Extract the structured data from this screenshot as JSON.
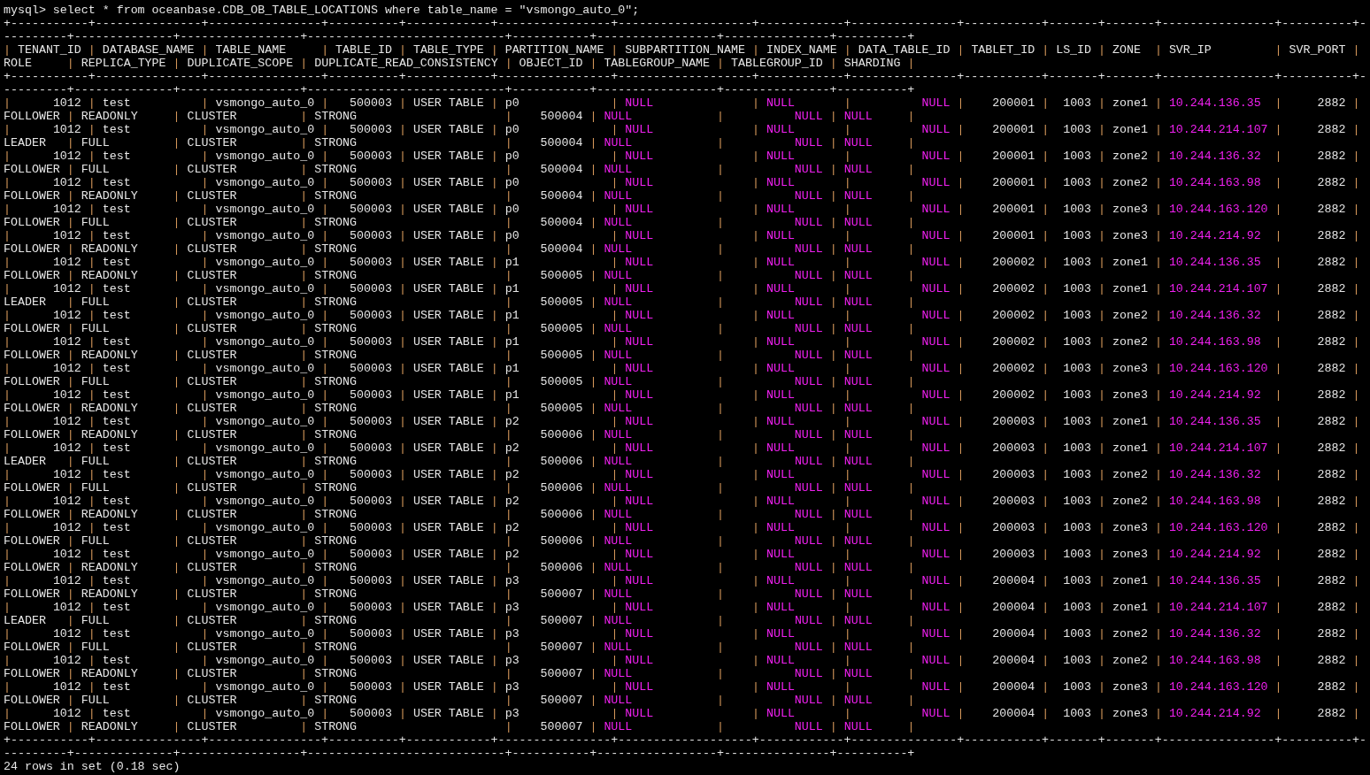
{
  "command_line": "mysql> select * from oceanbase.CDB_OB_TABLE_LOCATIONS where table_name = \"vsmongo_auto_0\";",
  "frame": {
    "bar": "|"
  },
  "border_top": [
    "+-----------+---------------+----------------+----------+------------+----------------+-------------------+------------+---------------+-----------+-------+-------+----------------+----------+-",
    "---------+--------------+-----------------+----------------------------+-----------+-----------------+---------------+----------+"
  ],
  "border_header": [
    "+-----------+---------------+----------------+----------+------------+----------------+-------------------+------------+---------------+-----------+-------+-------+----------------+----------+-",
    "---------+--------------+-----------------+----------------------------+-----------+-----------------+---------------+----------+"
  ],
  "border_bottom": [
    "+-----------+---------------+----------------+----------+------------+----------------+-------------------+------------+---------------+-----------+-------+-------+----------------+----------+-",
    "---------+--------------+-----------------+----------------------------+-----------+-----------------+---------------+----------+"
  ],
  "columns": [
    {
      "name": "TENANT_ID",
      "kind": "number"
    },
    {
      "name": "DATABASE_NAME",
      "kind": "text"
    },
    {
      "name": "TABLE_NAME",
      "kind": "text"
    },
    {
      "name": "TABLE_ID",
      "kind": "number"
    },
    {
      "name": "TABLE_TYPE",
      "kind": "text"
    },
    {
      "name": "PARTITION_NAME",
      "kind": "text"
    },
    {
      "name": "SUBPARTITION_NAME",
      "kind": "text"
    },
    {
      "name": "INDEX_NAME",
      "kind": "text"
    },
    {
      "name": "DATA_TABLE_ID",
      "kind": "number"
    },
    {
      "name": "TABLET_ID",
      "kind": "number"
    },
    {
      "name": "LS_ID",
      "kind": "number"
    },
    {
      "name": "ZONE",
      "kind": "text"
    },
    {
      "name": "SVR_IP",
      "kind": "address"
    },
    {
      "name": "SVR_PORT",
      "kind": "number"
    },
    {
      "name": "ROLE",
      "kind": "text"
    },
    {
      "name": "REPLICA_TYPE",
      "kind": "text"
    },
    {
      "name": "DUPLICATE_SCOPE",
      "kind": "text"
    },
    {
      "name": "DUPLICATE_READ_CONSISTENCY",
      "kind": "text"
    },
    {
      "name": "OBJECT_ID",
      "kind": "number"
    },
    {
      "name": "TABLEGROUP_NAME",
      "kind": "text"
    },
    {
      "name": "TABLEGROUP_ID",
      "kind": "number"
    },
    {
      "name": "SHARDING",
      "kind": "text"
    }
  ],
  "rows": [
    [
      "1012",
      "test",
      "vsmongo_auto_0",
      "500003",
      "USER TABLE",
      "p0",
      {
        "text": "NULL",
        "kind": "null"
      },
      {
        "text": "NULL",
        "kind": "null"
      },
      {
        "text": "NULL",
        "kind": "null"
      },
      "200001",
      "1003",
      "zone1",
      "10.244.136.35",
      "2882",
      "FOLLOWER",
      "READONLY",
      "CLUSTER",
      "STRONG",
      "500004",
      {
        "text": "NULL",
        "kind": "null"
      },
      {
        "text": "NULL",
        "kind": "null"
      },
      {
        "text": "NULL",
        "kind": "null"
      }
    ],
    [
      "1012",
      "test",
      "vsmongo_auto_0",
      "500003",
      "USER TABLE",
      "p0",
      {
        "text": "NULL",
        "kind": "null"
      },
      {
        "text": "NULL",
        "kind": "null"
      },
      {
        "text": "NULL",
        "kind": "null"
      },
      "200001",
      "1003",
      "zone1",
      "10.244.214.107",
      "2882",
      "LEADER",
      "FULL",
      "CLUSTER",
      "STRONG",
      "500004",
      {
        "text": "NULL",
        "kind": "null"
      },
      {
        "text": "NULL",
        "kind": "null"
      },
      {
        "text": "NULL",
        "kind": "null"
      }
    ],
    [
      "1012",
      "test",
      "vsmongo_auto_0",
      "500003",
      "USER TABLE",
      "p0",
      {
        "text": "NULL",
        "kind": "null"
      },
      {
        "text": "NULL",
        "kind": "null"
      },
      {
        "text": "NULL",
        "kind": "null"
      },
      "200001",
      "1003",
      "zone2",
      "10.244.136.32",
      "2882",
      "FOLLOWER",
      "FULL",
      "CLUSTER",
      "STRONG",
      "500004",
      {
        "text": "NULL",
        "kind": "null"
      },
      {
        "text": "NULL",
        "kind": "null"
      },
      {
        "text": "NULL",
        "kind": "null"
      }
    ],
    [
      "1012",
      "test",
      "vsmongo_auto_0",
      "500003",
      "USER TABLE",
      "p0",
      {
        "text": "NULL",
        "kind": "null"
      },
      {
        "text": "NULL",
        "kind": "null"
      },
      {
        "text": "NULL",
        "kind": "null"
      },
      "200001",
      "1003",
      "zone2",
      "10.244.163.98",
      "2882",
      "FOLLOWER",
      "READONLY",
      "CLUSTER",
      "STRONG",
      "500004",
      {
        "text": "NULL",
        "kind": "null"
      },
      {
        "text": "NULL",
        "kind": "null"
      },
      {
        "text": "NULL",
        "kind": "null"
      }
    ],
    [
      "1012",
      "test",
      "vsmongo_auto_0",
      "500003",
      "USER TABLE",
      "p0",
      {
        "text": "NULL",
        "kind": "null"
      },
      {
        "text": "NULL",
        "kind": "null"
      },
      {
        "text": "NULL",
        "kind": "null"
      },
      "200001",
      "1003",
      "zone3",
      "10.244.163.120",
      "2882",
      "FOLLOWER",
      "FULL",
      "CLUSTER",
      "STRONG",
      "500004",
      {
        "text": "NULL",
        "kind": "null"
      },
      {
        "text": "NULL",
        "kind": "null"
      },
      {
        "text": "NULL",
        "kind": "null"
      }
    ],
    [
      "1012",
      "test",
      "vsmongo_auto_0",
      "500003",
      "USER TABLE",
      "p0",
      {
        "text": "NULL",
        "kind": "null"
      },
      {
        "text": "NULL",
        "kind": "null"
      },
      {
        "text": "NULL",
        "kind": "null"
      },
      "200001",
      "1003",
      "zone3",
      "10.244.214.92",
      "2882",
      "FOLLOWER",
      "READONLY",
      "CLUSTER",
      "STRONG",
      "500004",
      {
        "text": "NULL",
        "kind": "null"
      },
      {
        "text": "NULL",
        "kind": "null"
      },
      {
        "text": "NULL",
        "kind": "null"
      }
    ],
    [
      "1012",
      "test",
      "vsmongo_auto_0",
      "500003",
      "USER TABLE",
      "p1",
      {
        "text": "NULL",
        "kind": "null"
      },
      {
        "text": "NULL",
        "kind": "null"
      },
      {
        "text": "NULL",
        "kind": "null"
      },
      "200002",
      "1003",
      "zone1",
      "10.244.136.35",
      "2882",
      "FOLLOWER",
      "READONLY",
      "CLUSTER",
      "STRONG",
      "500005",
      {
        "text": "NULL",
        "kind": "null"
      },
      {
        "text": "NULL",
        "kind": "null"
      },
      {
        "text": "NULL",
        "kind": "null"
      }
    ],
    [
      "1012",
      "test",
      "vsmongo_auto_0",
      "500003",
      "USER TABLE",
      "p1",
      {
        "text": "NULL",
        "kind": "null"
      },
      {
        "text": "NULL",
        "kind": "null"
      },
      {
        "text": "NULL",
        "kind": "null"
      },
      "200002",
      "1003",
      "zone1",
      "10.244.214.107",
      "2882",
      "LEADER",
      "FULL",
      "CLUSTER",
      "STRONG",
      "500005",
      {
        "text": "NULL",
        "kind": "null"
      },
      {
        "text": "NULL",
        "kind": "null"
      },
      {
        "text": "NULL",
        "kind": "null"
      }
    ],
    [
      "1012",
      "test",
      "vsmongo_auto_0",
      "500003",
      "USER TABLE",
      "p1",
      {
        "text": "NULL",
        "kind": "null"
      },
      {
        "text": "NULL",
        "kind": "null"
      },
      {
        "text": "NULL",
        "kind": "null"
      },
      "200002",
      "1003",
      "zone2",
      "10.244.136.32",
      "2882",
      "FOLLOWER",
      "FULL",
      "CLUSTER",
      "STRONG",
      "500005",
      {
        "text": "NULL",
        "kind": "null"
      },
      {
        "text": "NULL",
        "kind": "null"
      },
      {
        "text": "NULL",
        "kind": "null"
      }
    ],
    [
      "1012",
      "test",
      "vsmongo_auto_0",
      "500003",
      "USER TABLE",
      "p1",
      {
        "text": "NULL",
        "kind": "null"
      },
      {
        "text": "NULL",
        "kind": "null"
      },
      {
        "text": "NULL",
        "kind": "null"
      },
      "200002",
      "1003",
      "zone2",
      "10.244.163.98",
      "2882",
      "FOLLOWER",
      "READONLY",
      "CLUSTER",
      "STRONG",
      "500005",
      {
        "text": "NULL",
        "kind": "null"
      },
      {
        "text": "NULL",
        "kind": "null"
      },
      {
        "text": "NULL",
        "kind": "null"
      }
    ],
    [
      "1012",
      "test",
      "vsmongo_auto_0",
      "500003",
      "USER TABLE",
      "p1",
      {
        "text": "NULL",
        "kind": "null"
      },
      {
        "text": "NULL",
        "kind": "null"
      },
      {
        "text": "NULL",
        "kind": "null"
      },
      "200002",
      "1003",
      "zone3",
      "10.244.163.120",
      "2882",
      "FOLLOWER",
      "FULL",
      "CLUSTER",
      "STRONG",
      "500005",
      {
        "text": "NULL",
        "kind": "null"
      },
      {
        "text": "NULL",
        "kind": "null"
      },
      {
        "text": "NULL",
        "kind": "null"
      }
    ],
    [
      "1012",
      "test",
      "vsmongo_auto_0",
      "500003",
      "USER TABLE",
      "p1",
      {
        "text": "NULL",
        "kind": "null"
      },
      {
        "text": "NULL",
        "kind": "null"
      },
      {
        "text": "NULL",
        "kind": "null"
      },
      "200002",
      "1003",
      "zone3",
      "10.244.214.92",
      "2882",
      "FOLLOWER",
      "READONLY",
      "CLUSTER",
      "STRONG",
      "500005",
      {
        "text": "NULL",
        "kind": "null"
      },
      {
        "text": "NULL",
        "kind": "null"
      },
      {
        "text": "NULL",
        "kind": "null"
      }
    ],
    [
      "1012",
      "test",
      "vsmongo_auto_0",
      "500003",
      "USER TABLE",
      "p2",
      {
        "text": "NULL",
        "kind": "null"
      },
      {
        "text": "NULL",
        "kind": "null"
      },
      {
        "text": "NULL",
        "kind": "null"
      },
      "200003",
      "1003",
      "zone1",
      "10.244.136.35",
      "2882",
      "FOLLOWER",
      "READONLY",
      "CLUSTER",
      "STRONG",
      "500006",
      {
        "text": "NULL",
        "kind": "null"
      },
      {
        "text": "NULL",
        "kind": "null"
      },
      {
        "text": "NULL",
        "kind": "null"
      }
    ],
    [
      "1012",
      "test",
      "vsmongo_auto_0",
      "500003",
      "USER TABLE",
      "p2",
      {
        "text": "NULL",
        "kind": "null"
      },
      {
        "text": "NULL",
        "kind": "null"
      },
      {
        "text": "NULL",
        "kind": "null"
      },
      "200003",
      "1003",
      "zone1",
      "10.244.214.107",
      "2882",
      "LEADER",
      "FULL",
      "CLUSTER",
      "STRONG",
      "500006",
      {
        "text": "NULL",
        "kind": "null"
      },
      {
        "text": "NULL",
        "kind": "null"
      },
      {
        "text": "NULL",
        "kind": "null"
      }
    ],
    [
      "1012",
      "test",
      "vsmongo_auto_0",
      "500003",
      "USER TABLE",
      "p2",
      {
        "text": "NULL",
        "kind": "null"
      },
      {
        "text": "NULL",
        "kind": "null"
      },
      {
        "text": "NULL",
        "kind": "null"
      },
      "200003",
      "1003",
      "zone2",
      "10.244.136.32",
      "2882",
      "FOLLOWER",
      "FULL",
      "CLUSTER",
      "STRONG",
      "500006",
      {
        "text": "NULL",
        "kind": "null"
      },
      {
        "text": "NULL",
        "kind": "null"
      },
      {
        "text": "NULL",
        "kind": "null"
      }
    ],
    [
      "1012",
      "test",
      "vsmongo_auto_0",
      "500003",
      "USER TABLE",
      "p2",
      {
        "text": "NULL",
        "kind": "null"
      },
      {
        "text": "NULL",
        "kind": "null"
      },
      {
        "text": "NULL",
        "kind": "null"
      },
      "200003",
      "1003",
      "zone2",
      "10.244.163.98",
      "2882",
      "FOLLOWER",
      "READONLY",
      "CLUSTER",
      "STRONG",
      "500006",
      {
        "text": "NULL",
        "kind": "null"
      },
      {
        "text": "NULL",
        "kind": "null"
      },
      {
        "text": "NULL",
        "kind": "null"
      }
    ],
    [
      "1012",
      "test",
      "vsmongo_auto_0",
      "500003",
      "USER TABLE",
      "p2",
      {
        "text": "NULL",
        "kind": "null"
      },
      {
        "text": "NULL",
        "kind": "null"
      },
      {
        "text": "NULL",
        "kind": "null"
      },
      "200003",
      "1003",
      "zone3",
      "10.244.163.120",
      "2882",
      "FOLLOWER",
      "FULL",
      "CLUSTER",
      "STRONG",
      "500006",
      {
        "text": "NULL",
        "kind": "null"
      },
      {
        "text": "NULL",
        "kind": "null"
      },
      {
        "text": "NULL",
        "kind": "null"
      }
    ],
    [
      "1012",
      "test",
      "vsmongo_auto_0",
      "500003",
      "USER TABLE",
      "p2",
      {
        "text": "NULL",
        "kind": "null"
      },
      {
        "text": "NULL",
        "kind": "null"
      },
      {
        "text": "NULL",
        "kind": "null"
      },
      "200003",
      "1003",
      "zone3",
      "10.244.214.92",
      "2882",
      "FOLLOWER",
      "READONLY",
      "CLUSTER",
      "STRONG",
      "500006",
      {
        "text": "NULL",
        "kind": "null"
      },
      {
        "text": "NULL",
        "kind": "null"
      },
      {
        "text": "NULL",
        "kind": "null"
      }
    ],
    [
      "1012",
      "test",
      "vsmongo_auto_0",
      "500003",
      "USER TABLE",
      "p3",
      {
        "text": "NULL",
        "kind": "null"
      },
      {
        "text": "NULL",
        "kind": "null"
      },
      {
        "text": "NULL",
        "kind": "null"
      },
      "200004",
      "1003",
      "zone1",
      "10.244.136.35",
      "2882",
      "FOLLOWER",
      "READONLY",
      "CLUSTER",
      "STRONG",
      "500007",
      {
        "text": "NULL",
        "kind": "null"
      },
      {
        "text": "NULL",
        "kind": "null"
      },
      {
        "text": "NULL",
        "kind": "null"
      }
    ],
    [
      "1012",
      "test",
      "vsmongo_auto_0",
      "500003",
      "USER TABLE",
      "p3",
      {
        "text": "NULL",
        "kind": "null"
      },
      {
        "text": "NULL",
        "kind": "null"
      },
      {
        "text": "NULL",
        "kind": "null"
      },
      "200004",
      "1003",
      "zone1",
      "10.244.214.107",
      "2882",
      "LEADER",
      "FULL",
      "CLUSTER",
      "STRONG",
      "500007",
      {
        "text": "NULL",
        "kind": "null"
      },
      {
        "text": "NULL",
        "kind": "null"
      },
      {
        "text": "NULL",
        "kind": "null"
      }
    ],
    [
      "1012",
      "test",
      "vsmongo_auto_0",
      "500003",
      "USER TABLE",
      "p3",
      {
        "text": "NULL",
        "kind": "null"
      },
      {
        "text": "NULL",
        "kind": "null"
      },
      {
        "text": "NULL",
        "kind": "null"
      },
      "200004",
      "1003",
      "zone2",
      "10.244.136.32",
      "2882",
      "FOLLOWER",
      "FULL",
      "CLUSTER",
      "STRONG",
      "500007",
      {
        "text": "NULL",
        "kind": "null"
      },
      {
        "text": "NULL",
        "kind": "null"
      },
      {
        "text": "NULL",
        "kind": "null"
      }
    ],
    [
      "1012",
      "test",
      "vsmongo_auto_0",
      "500003",
      "USER TABLE",
      "p3",
      {
        "text": "NULL",
        "kind": "null"
      },
      {
        "text": "NULL",
        "kind": "null"
      },
      {
        "text": "NULL",
        "kind": "null"
      },
      "200004",
      "1003",
      "zone2",
      "10.244.163.98",
      "2882",
      "FOLLOWER",
      "READONLY",
      "CLUSTER",
      "STRONG",
      "500007",
      {
        "text": "NULL",
        "kind": "null"
      },
      {
        "text": "NULL",
        "kind": "null"
      },
      {
        "text": "NULL",
        "kind": "null"
      }
    ],
    [
      "1012",
      "test",
      "vsmongo_auto_0",
      "500003",
      "USER TABLE",
      "p3",
      {
        "text": "NULL",
        "kind": "null"
      },
      {
        "text": "NULL",
        "kind": "null"
      },
      {
        "text": "NULL",
        "kind": "null"
      },
      "200004",
      "1003",
      "zone3",
      "10.244.163.120",
      "2882",
      "FOLLOWER",
      "FULL",
      "CLUSTER",
      "STRONG",
      "500007",
      {
        "text": "NULL",
        "kind": "null"
      },
      {
        "text": "NULL",
        "kind": "null"
      },
      {
        "text": "NULL",
        "kind": "null"
      }
    ],
    [
      "1012",
      "test",
      "vsmongo_auto_0",
      "500003",
      "USER TABLE",
      "p3",
      {
        "text": "NULL",
        "kind": "null"
      },
      {
        "text": "NULL",
        "kind": "null"
      },
      {
        "text": "NULL",
        "kind": "null"
      },
      "200004",
      "1003",
      "zone3",
      "10.244.214.92",
      "2882",
      "FOLLOWER",
      "READONLY",
      "CLUSTER",
      "STRONG",
      "500007",
      {
        "text": "NULL",
        "kind": "null"
      },
      {
        "text": "NULL",
        "kind": "null"
      },
      {
        "text": "NULL",
        "kind": "null"
      }
    ]
  ],
  "summary": "24 rows in set (0.18 sec)"
}
